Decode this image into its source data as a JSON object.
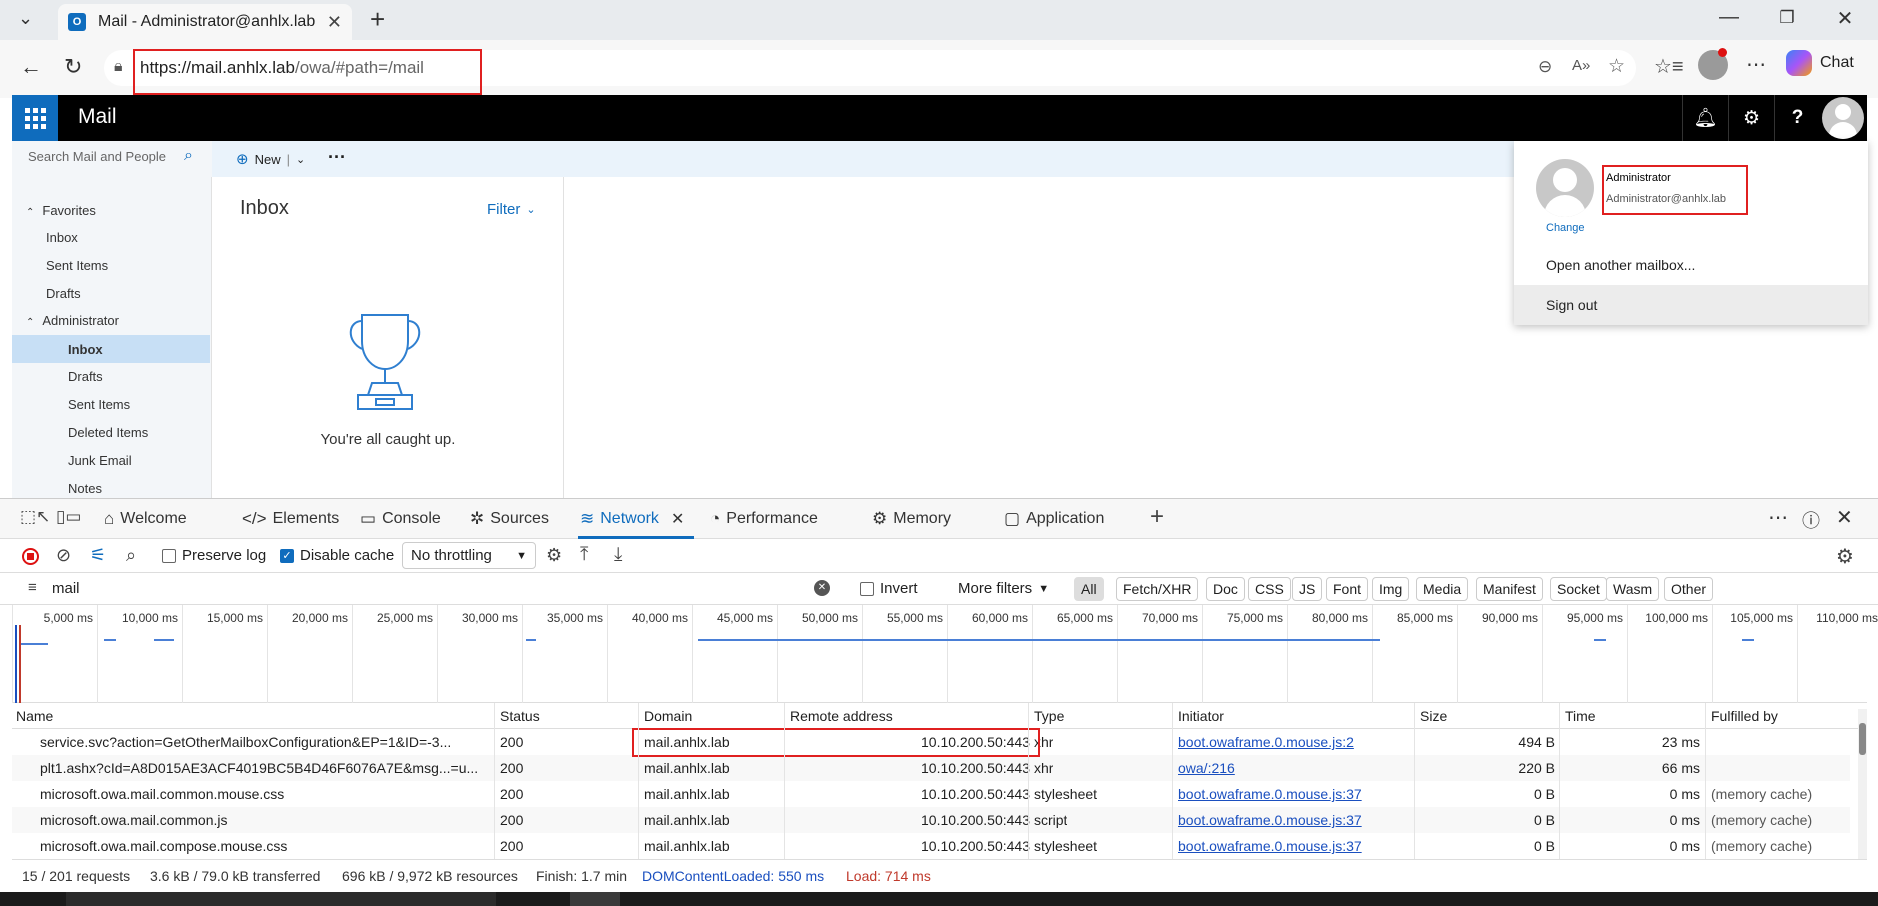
{
  "browser": {
    "tab_title": "Mail - Administrator@anhlx.lab",
    "tab_icon_letter": "O",
    "url_host": "https://mail.anhlx.lab",
    "url_path": "/owa/#path=/mail",
    "chat_label": "Chat"
  },
  "owa": {
    "app_title": "Mail",
    "search_placeholder": "Search Mail and People",
    "new_label": "New",
    "inbox_title": "Inbox",
    "filter_label": "Filter",
    "empty_message": "You're all caught up.",
    "nav": {
      "favorites": "Favorites",
      "fav_items": [
        "Inbox",
        "Sent Items",
        "Drafts"
      ],
      "account": "Administrator",
      "account_items": [
        "Inbox",
        "Drafts",
        "Sent Items",
        "Deleted Items",
        "Junk Email",
        "Notes"
      ]
    },
    "profile": {
      "name": "Administrator",
      "email": "Administrator@anhlx.lab",
      "change": "Change",
      "open_another": "Open another mailbox...",
      "sign_out": "Sign out"
    }
  },
  "devtools": {
    "tabs": [
      "Welcome",
      "Elements",
      "Console",
      "Sources",
      "Network",
      "Performance",
      "Memory",
      "Application"
    ],
    "toolbar": {
      "preserve_log": "Preserve log",
      "disable_cache": "Disable cache",
      "throttling": "No throttling"
    },
    "filter": {
      "value": "mail",
      "invert": "Invert",
      "more_filters": "More filters",
      "types": [
        "All",
        "Fetch/XHR",
        "Doc",
        "CSS",
        "JS",
        "Font",
        "Img",
        "Media",
        "Manifest",
        "Socket",
        "Wasm",
        "Other"
      ]
    },
    "timeline_ticks": [
      "5,000 ms",
      "10,000 ms",
      "15,000 ms",
      "20,000 ms",
      "25,000 ms",
      "30,000 ms",
      "35,000 ms",
      "40,000 ms",
      "45,000 ms",
      "50,000 ms",
      "55,000 ms",
      "60,000 ms",
      "65,000 ms",
      "70,000 ms",
      "75,000 ms",
      "80,000 ms",
      "85,000 ms",
      "90,000 ms",
      "95,000 ms",
      "100,000 ms",
      "105,000 ms",
      "110,000 ms"
    ],
    "columns": [
      "Name",
      "Status",
      "Domain",
      "Remote address",
      "Type",
      "Initiator",
      "Size",
      "Time",
      "Fulfilled by"
    ],
    "rows": [
      {
        "name": "service.svc?action=GetOtherMailboxConfiguration&EP=1&ID=-3...",
        "status": "200",
        "domain": "mail.anhlx.lab",
        "remote": "10.10.200.50:443",
        "type": "xhr",
        "initiator": "boot.owaframe.0.mouse.js:2",
        "size": "494 B",
        "time": "23 ms",
        "fulfilled": ""
      },
      {
        "name": "plt1.ashx?cId=A8D015AE3ACF4019BC5B4D46F6076A7E&msg...=u...",
        "status": "200",
        "domain": "mail.anhlx.lab",
        "remote": "10.10.200.50:443",
        "type": "xhr",
        "initiator": "owa/:216",
        "size": "220 B",
        "time": "66 ms",
        "fulfilled": ""
      },
      {
        "name": "microsoft.owa.mail.common.mouse.css",
        "status": "200",
        "domain": "mail.anhlx.lab",
        "remote": "10.10.200.50:443",
        "type": "stylesheet",
        "initiator": "boot.owaframe.0.mouse.js:37",
        "size": "0 B",
        "time": "0 ms",
        "fulfilled": "(memory cache)"
      },
      {
        "name": "microsoft.owa.mail.common.js",
        "status": "200",
        "domain": "mail.anhlx.lab",
        "remote": "10.10.200.50:443",
        "type": "script",
        "initiator": "boot.owaframe.0.mouse.js:37",
        "size": "0 B",
        "time": "0 ms",
        "fulfilled": "(memory cache)"
      },
      {
        "name": "microsoft.owa.mail.compose.mouse.css",
        "status": "200",
        "domain": "mail.anhlx.lab",
        "remote": "10.10.200.50:443",
        "type": "stylesheet",
        "initiator": "boot.owaframe.0.mouse.js:37",
        "size": "0 B",
        "time": "0 ms",
        "fulfilled": "(memory cache)"
      }
    ],
    "status": {
      "requests": "15 / 201 requests",
      "transferred": "3.6 kB / 79.0 kB transferred",
      "resources": "696 kB / 9,972 kB resources",
      "finish": "Finish: 1.7 min",
      "dcl": "DOMContentLoaded: 550 ms",
      "load": "Load: 714 ms"
    }
  },
  "colors": {
    "accent": "#0f6cbd",
    "highlight": "#e02020",
    "dcl": "#1a4fbf",
    "load": "#c0392b"
  }
}
